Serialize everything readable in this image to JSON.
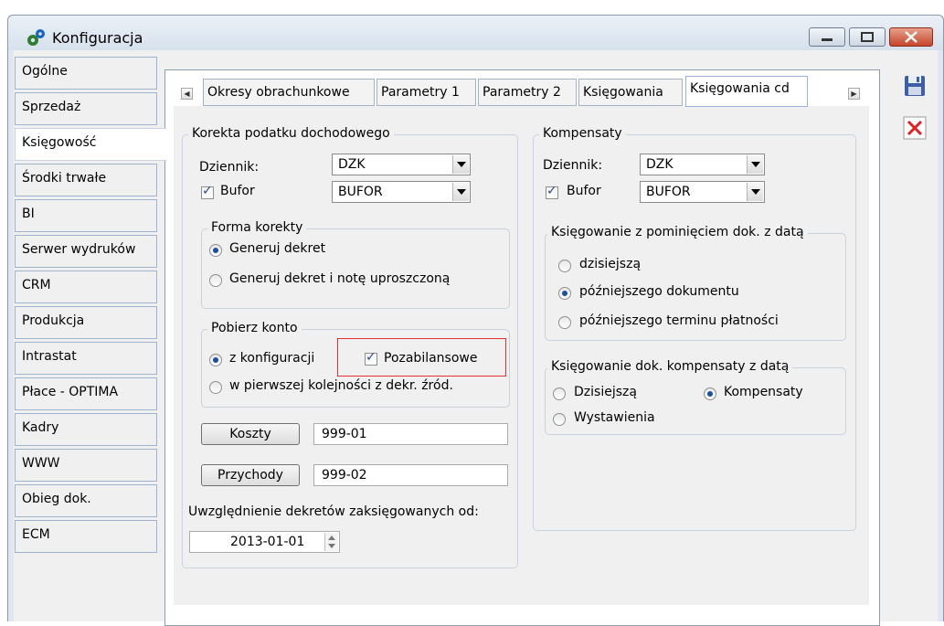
{
  "window": {
    "title": "Konfiguracja"
  },
  "sidebar": {
    "items": [
      {
        "label": "Ogólne"
      },
      {
        "label": "Sprzedaż"
      },
      {
        "label": "Księgowość"
      },
      {
        "label": "Środki trwałe"
      },
      {
        "label": "BI"
      },
      {
        "label": "Serwer wydruków"
      },
      {
        "label": "CRM"
      },
      {
        "label": "Produkcja"
      },
      {
        "label": "Intrastat"
      },
      {
        "label": "Płace - OPTIMA"
      },
      {
        "label": "Kadry"
      },
      {
        "label": "WWW"
      },
      {
        "label": "Obieg dok."
      },
      {
        "label": "ECM"
      }
    ],
    "active": "Księgowość"
  },
  "tabs": [
    {
      "label": "Okresy obrachunkowe"
    },
    {
      "label": "Parametry 1"
    },
    {
      "label": "Parametry 2"
    },
    {
      "label": "Księgowania"
    },
    {
      "label": "Księgowania cd"
    }
  ],
  "korekta": {
    "title": "Korekta podatku dochodowego",
    "dziennik_label": "Dziennik:",
    "dziennik_value": "DZK",
    "bufor_label": "Bufor",
    "bufor_checked": true,
    "bufor_value": "BUFOR",
    "forma": {
      "title": "Forma korekty",
      "opt1": "Generuj dekret",
      "opt2": "Generuj dekret i notę uproszczoną",
      "selected": 1
    },
    "pobierz": {
      "title": "Pobierz konto",
      "opt1": "z konfiguracji",
      "opt2": "w pierwszej kolejności z dekr. źród.",
      "selected": 1,
      "pozabilansowe_label": "Pozabilansowe",
      "pozabilansowe_checked": true
    },
    "koszty_label": "Koszty",
    "koszty_value": "999-01",
    "przychody_label": "Przychody",
    "przychody_value": "999-02",
    "uwzglednienie_label": "Uwzględnienie dekretów zaksięgowanych od:",
    "date_value": "2013-01-01"
  },
  "kompensaty": {
    "title": "Kompensaty",
    "dziennik_label": "Dziennik:",
    "dziennik_value": "DZK",
    "bufor_label": "Bufor",
    "bufor_checked": true,
    "bufor_value": "BUFOR",
    "pominieciem": {
      "title": "Księgowanie z pominięciem dok. z datą",
      "opt1": "dzisiejszą",
      "opt2": "późniejszego dokumentu",
      "opt3": "późniejszego terminu płatności",
      "selected": 2
    },
    "dokdata": {
      "title": "Księgowanie dok. kompensaty z datą",
      "opt1": "Dzisiejszą",
      "opt2": "Kompensaty",
      "opt3": "Wystawienia",
      "selected": 2
    }
  },
  "toolbar": {
    "save_icon": "floppy-disk-icon",
    "close_icon": "red-x-icon"
  },
  "colors": {
    "accent_blue": "#1b4ea7",
    "highlight_red": "#e03030",
    "tab_border": "#9bb3d2"
  }
}
